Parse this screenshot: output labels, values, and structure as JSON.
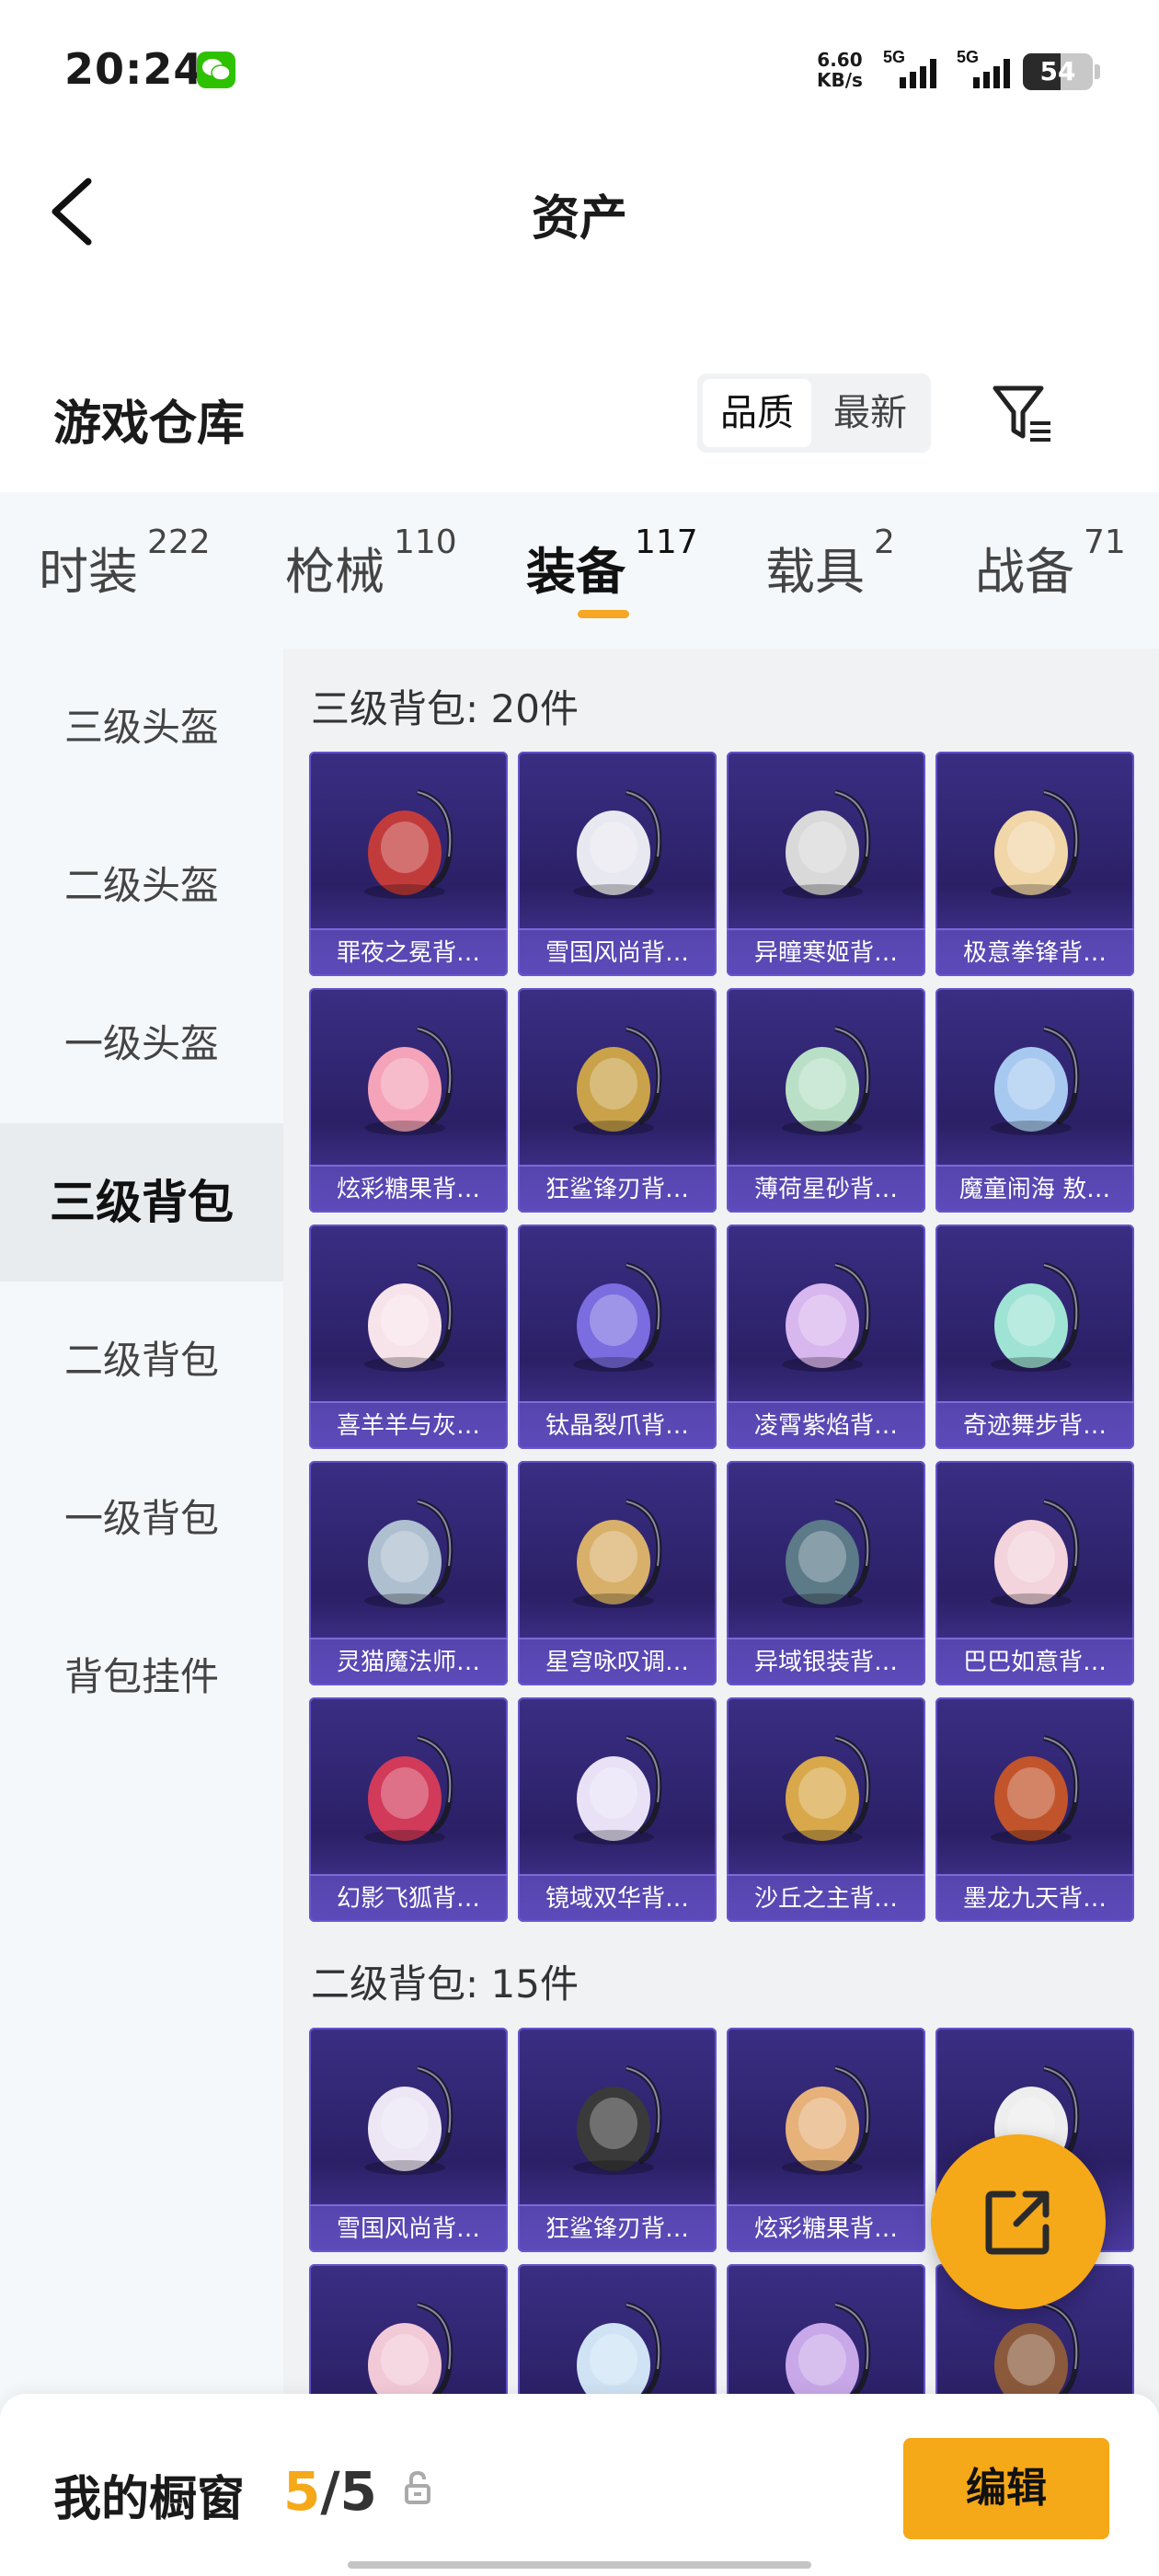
{
  "status": {
    "time": "20:24",
    "net_speed_value": "6.60",
    "net_speed_unit": "KB/s",
    "sim1": "5G",
    "sim2": "5G",
    "battery": "54",
    "battery_level": 0.54
  },
  "header": {
    "title": "资产"
  },
  "warehouse": {
    "title": "游戏仓库",
    "sort_options": [
      "品质",
      "最新"
    ],
    "active_sort": "品质"
  },
  "tabs": [
    {
      "label": "时装",
      "count": "222"
    },
    {
      "label": "枪械",
      "count": "110"
    },
    {
      "label": "装备",
      "count": "117",
      "active": true
    },
    {
      "label": "载具",
      "count": "2"
    },
    {
      "label": "战备",
      "count": "71"
    }
  ],
  "sidebar": {
    "items": [
      "三级头盔",
      "二级头盔",
      "一级头盔",
      "三级背包",
      "二级背包",
      "一级背包",
      "背包挂件"
    ],
    "active": "三级背包"
  },
  "groups": [
    {
      "title": "三级背包: 20件",
      "items": [
        "罪夜之冕背…",
        "雪国风尚背…",
        "异瞳寒姬背…",
        "极意拳锋背…",
        "炫彩糖果背…",
        "狂鲨锋刃背…",
        "薄荷星砂背…",
        "魔童闹海 敖…",
        "喜羊羊与灰…",
        "钛晶裂爪背…",
        "凌霄紫焰背…",
        "奇迹舞步背…",
        "灵猫魔法师…",
        "星穹咏叹调…",
        "异域银装背…",
        "巴巴如意背…",
        "幻影飞狐背…",
        "镜域双华背…",
        "沙丘之主背…",
        "墨龙九天背…"
      ]
    },
    {
      "title": "二级背包: 15件",
      "items": [
        "雪国风尚背…",
        "狂鲨锋刃背…",
        "炫彩糖果背…",
        "",
        "",
        "",
        "",
        ""
      ]
    }
  ],
  "bottom_bar": {
    "label": "我的橱窗",
    "current": "5",
    "separator": "/",
    "total": "5",
    "edit": "编辑"
  },
  "colors": {
    "accent": "#f5a818",
    "card_top": "#3a2e84",
    "card_caption": "#6e5ad2"
  },
  "icons": {
    "back": "chevron-left-icon",
    "filter": "filter-list-icon",
    "share": "share-external-icon",
    "lock": "lock-icon"
  }
}
